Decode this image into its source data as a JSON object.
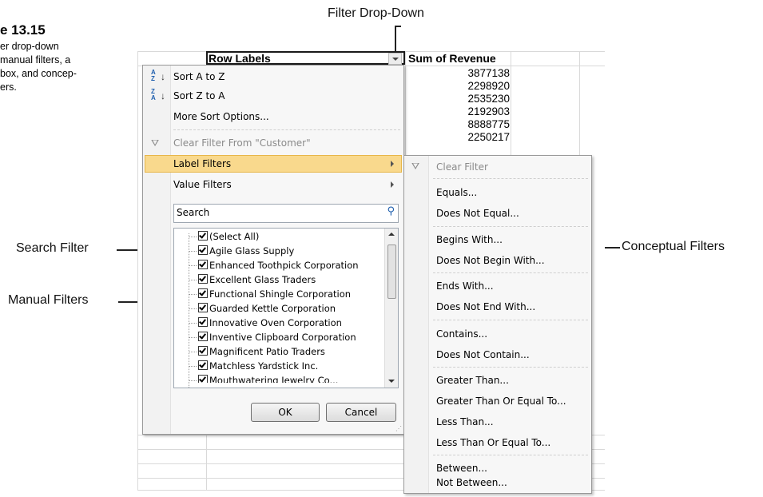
{
  "figure": {
    "title": "e 13.15",
    "caption": "er drop-down\nmanual filters, a\nbox, and concep-\ners."
  },
  "callouts": {
    "filter_dropdown": "Filter Drop-Down",
    "search_filter": "Search Filter",
    "manual_filters": "Manual Filters",
    "conceptual_filters": "Conceptual Filters"
  },
  "pivot": {
    "row_labels": "Row Labels",
    "sum_header": "Sum of Revenue",
    "revenues": [
      "3877138",
      "2298920",
      "2535230",
      "2192903",
      "8888775",
      "2250217"
    ]
  },
  "main_menu": {
    "items": [
      {
        "label": "Sort A to Z",
        "icon": "sort-a-z-icon",
        "enabled": true
      },
      {
        "label": "Sort Z to A",
        "icon": "sort-z-a-icon",
        "enabled": true
      },
      {
        "label": "More Sort Options...",
        "enabled": true
      },
      {
        "label": "Clear Filter From \"Customer\"",
        "icon": "clear-filter-icon",
        "enabled": false
      },
      {
        "label": "Label Filters",
        "submenu": true,
        "highlighted": true
      },
      {
        "label": "Value Filters",
        "submenu": true
      }
    ],
    "search_placeholder": "Search",
    "list": [
      "(Select All)",
      "Agile Glass Supply",
      "Enhanced Toothpick Corporation",
      "Excellent Glass Traders",
      "Functional Shingle Corporation",
      "Guarded Kettle Corporation",
      "Innovative Oven Corporation",
      "Inventive Clipboard Corporation",
      "Magnificent Patio Traders",
      "Matchless Yardstick Inc.",
      "Mouthwatering Jewelry Co..."
    ],
    "ok": "OK",
    "cancel": "Cancel"
  },
  "sub_menu": {
    "items": [
      {
        "label": "Clear Filter",
        "enabled": false
      },
      {
        "label": "Equals..."
      },
      {
        "label": "Does Not Equal..."
      },
      {
        "label": "Begins With..."
      },
      {
        "label": "Does Not Begin With..."
      },
      {
        "label": "Ends With..."
      },
      {
        "label": "Does Not End With..."
      },
      {
        "label": "Contains..."
      },
      {
        "label": "Does Not Contain..."
      },
      {
        "label": "Greater Than..."
      },
      {
        "label": "Greater Than Or Equal To..."
      },
      {
        "label": "Less Than..."
      },
      {
        "label": "Less Than Or Equal To..."
      },
      {
        "label": "Between..."
      },
      {
        "label": "Not Between..."
      }
    ]
  },
  "colors": {
    "highlight": "#f9d98d",
    "grid": "#d9d9d9",
    "menu_bg": "#f7f7f7"
  }
}
